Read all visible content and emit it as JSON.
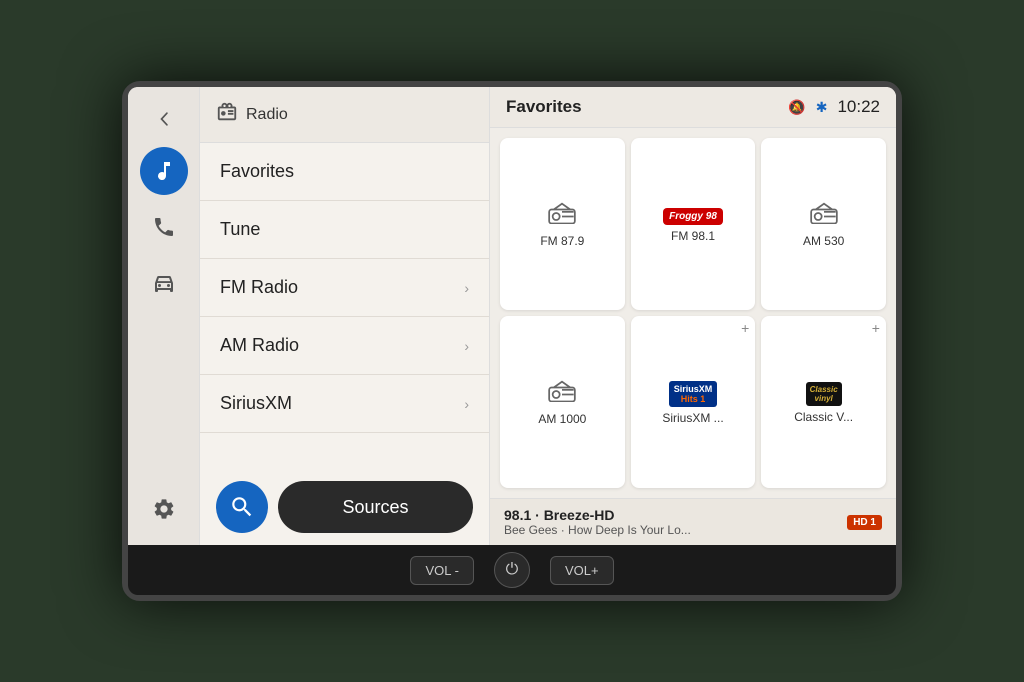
{
  "screen": {
    "sidebar": {
      "back_icon": "◀",
      "icons": [
        {
          "name": "music-icon",
          "label": "Music",
          "active": true,
          "symbol": "♪"
        },
        {
          "name": "phone-icon",
          "label": "Phone",
          "active": false,
          "symbol": "✆"
        },
        {
          "name": "car-icon",
          "label": "Car",
          "active": false,
          "symbol": "🚗"
        },
        {
          "name": "settings-icon",
          "label": "Settings",
          "active": false,
          "symbol": "⚙"
        }
      ]
    },
    "menu": {
      "header_icon": "📻",
      "header_title": "Radio",
      "items": [
        {
          "label": "Favorites",
          "has_arrow": false
        },
        {
          "label": "Tune",
          "has_arrow": false
        },
        {
          "label": "FM Radio",
          "has_arrow": true
        },
        {
          "label": "AM Radio",
          "has_arrow": true
        },
        {
          "label": "SiriusXM",
          "has_arrow": true
        }
      ],
      "search_label": "🔍",
      "sources_label": "Sources"
    },
    "content": {
      "title": "Favorites",
      "time": "10:22",
      "bluetooth_icon": "🔵",
      "mute_icon": "🔇",
      "favorites": [
        {
          "id": "fm879",
          "label": "FM 87.9",
          "has_logo": false,
          "is_radio": true
        },
        {
          "id": "fm981",
          "label": "FM 98.1",
          "has_logo": true,
          "logo_type": "fm981",
          "is_radio": false
        },
        {
          "id": "am530",
          "label": "AM 530",
          "has_logo": false,
          "is_radio": true
        },
        {
          "id": "am1000",
          "label": "AM 1000",
          "has_logo": false,
          "is_radio": true,
          "has_add": false
        },
        {
          "id": "siriusxm",
          "label": "SiriusXM ...",
          "has_logo": true,
          "logo_type": "sirius",
          "is_radio": false,
          "has_add": true
        },
        {
          "id": "classicvinyl",
          "label": "Classic V...",
          "has_logo": true,
          "logo_type": "classicvinyl",
          "is_radio": false,
          "has_add": true
        }
      ],
      "now_playing": {
        "station": "98.1 · Breeze-HD",
        "song": "Bee Gees · How Deep Is Your Lo...",
        "badge": "HD 1"
      }
    }
  },
  "controls": {
    "vol_minus": "VOL -",
    "power": "⏻",
    "vol_plus": "VOL+"
  }
}
